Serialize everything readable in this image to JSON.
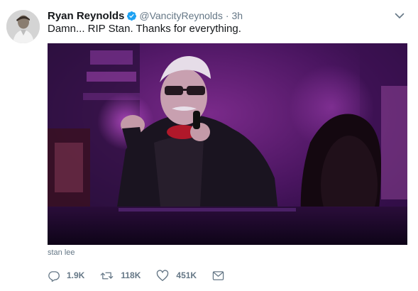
{
  "author": {
    "display_name": "Ryan Reynolds",
    "handle": "@VancityReynolds",
    "separator": "·",
    "time": "3h"
  },
  "tweet": {
    "text": "Damn... RIP Stan. Thanks for everything."
  },
  "media": {
    "caption": "stan lee"
  },
  "actions": {
    "replies": "1.9K",
    "retweets": "118K",
    "likes": "451K"
  },
  "icons": {
    "verified": "verified-badge-icon",
    "caret": "chevron-down-icon",
    "reply": "reply-icon",
    "retweet": "retweet-icon",
    "like": "heart-icon",
    "dm": "envelope-icon"
  },
  "colors": {
    "verified": "#1da1f2",
    "secondary_text": "#657786",
    "primary_text": "#14171a"
  }
}
